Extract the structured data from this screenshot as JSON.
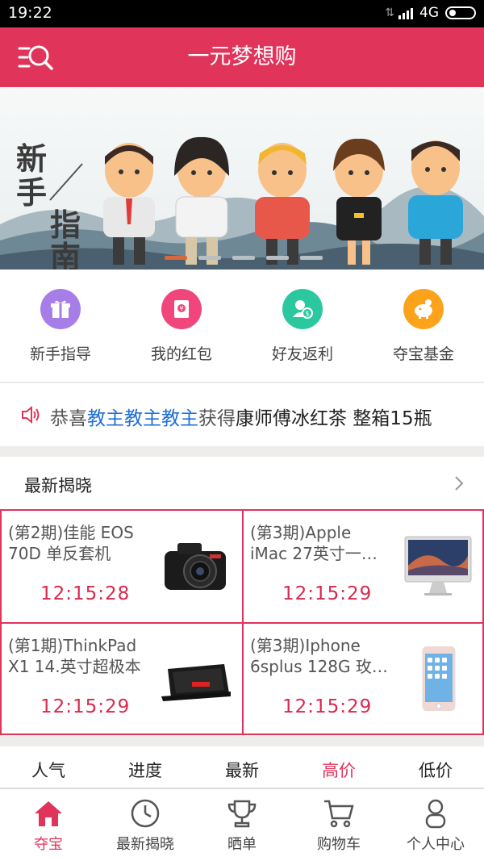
{
  "status": {
    "time": "19:22",
    "network": "4G"
  },
  "header": {
    "title": "一元梦想购"
  },
  "banner": {
    "title_chars": [
      "新",
      "手",
      "指",
      "南"
    ]
  },
  "quick_nav": [
    {
      "label": "新手指导",
      "icon": "gift-icon",
      "color": "#a77ee8"
    },
    {
      "label": "我的红包",
      "icon": "red-envelope-icon",
      "color": "#f0467b"
    },
    {
      "label": "好友返利",
      "icon": "friend-rebate-icon",
      "color": "#2bc8a0"
    },
    {
      "label": "夺宝基金",
      "icon": "piggy-bank-icon",
      "color": "#fca21b"
    }
  ],
  "notice": {
    "prefix": "恭喜",
    "user": "教主教主教主",
    "mid": "获得",
    "prize": "康师傅冰红茶 整箱15瓶"
  },
  "latest": {
    "title": "最新揭晓",
    "items": [
      {
        "line1": "(第2期)佳能 EOS",
        "line2": "70D 单反套机",
        "countdown": "12:15:28",
        "image": "camera-image"
      },
      {
        "line1": "(第3期)Apple",
        "line2": "iMac 27英寸一…",
        "countdown": "12:15:29",
        "image": "imac-image"
      },
      {
        "line1": "(第1期)ThinkPad",
        "line2": "X1 14.英寸超极本",
        "countdown": "12:15:29",
        "image": "laptop-image"
      },
      {
        "line1": "(第3期)Iphone",
        "line2": "6splus 128G 玫…",
        "countdown": "12:15:29",
        "image": "iphone-image"
      }
    ]
  },
  "sort_tabs": [
    {
      "label": "人气",
      "active": false
    },
    {
      "label": "进度",
      "active": false
    },
    {
      "label": "最新",
      "active": false
    },
    {
      "label": "高价",
      "active": true
    },
    {
      "label": "低价",
      "active": false
    }
  ],
  "tabbar": [
    {
      "label": "夺宝",
      "icon": "home-icon",
      "active": true
    },
    {
      "label": "最新揭晓",
      "icon": "clock-icon",
      "active": false
    },
    {
      "label": "晒单",
      "icon": "trophy-icon",
      "active": false
    },
    {
      "label": "购物车",
      "icon": "cart-icon",
      "active": false
    },
    {
      "label": "个人中心",
      "icon": "user-icon",
      "active": false
    }
  ],
  "colors": {
    "brand": "#e0345b",
    "notice_user": "#1f6fd8"
  }
}
